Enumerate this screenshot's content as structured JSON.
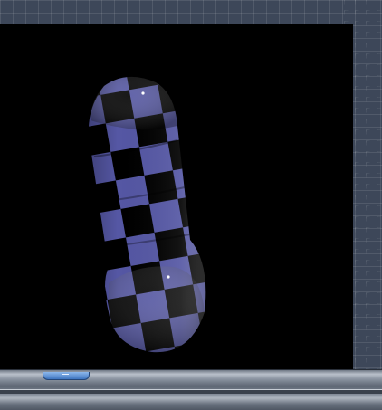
{
  "scene": {
    "object": "checkered-capsule",
    "material_color": "#5558a6",
    "checker_color": "#000000",
    "background_color": "#000000"
  },
  "ui": {
    "frame_color": "#3d4759",
    "handle_color": "#4a82cc"
  }
}
